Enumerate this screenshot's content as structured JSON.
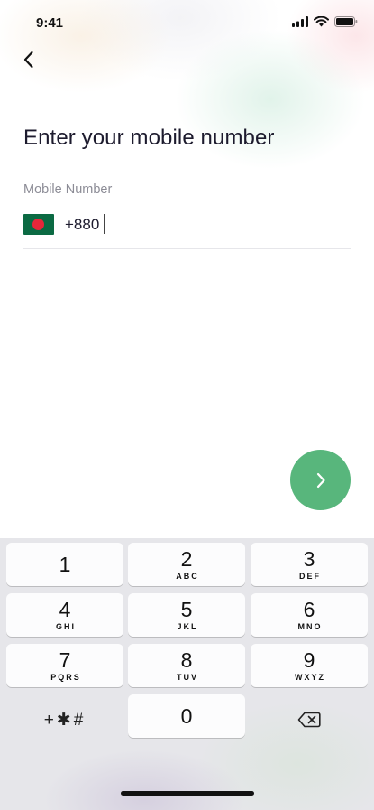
{
  "status_bar": {
    "time": "9:41"
  },
  "header": {
    "title": "Enter your mobile number"
  },
  "form": {
    "field_label": "Mobile Number",
    "country_code": "+880",
    "flag": "bangladesh-flag"
  },
  "keyboard": {
    "keys": [
      {
        "num": "1",
        "letters": ""
      },
      {
        "num": "2",
        "letters": "ABC"
      },
      {
        "num": "3",
        "letters": "DEF"
      },
      {
        "num": "4",
        "letters": "GHI"
      },
      {
        "num": "5",
        "letters": "JKL"
      },
      {
        "num": "6",
        "letters": "MNO"
      },
      {
        "num": "7",
        "letters": "PQRS"
      },
      {
        "num": "8",
        "letters": "TUV"
      },
      {
        "num": "9",
        "letters": "WXYZ"
      }
    ],
    "symbols": "+✱#",
    "zero": "0"
  },
  "colors": {
    "accent": "#58b67c",
    "flag_green": "#0b6a43",
    "flag_red": "#e8273a"
  }
}
